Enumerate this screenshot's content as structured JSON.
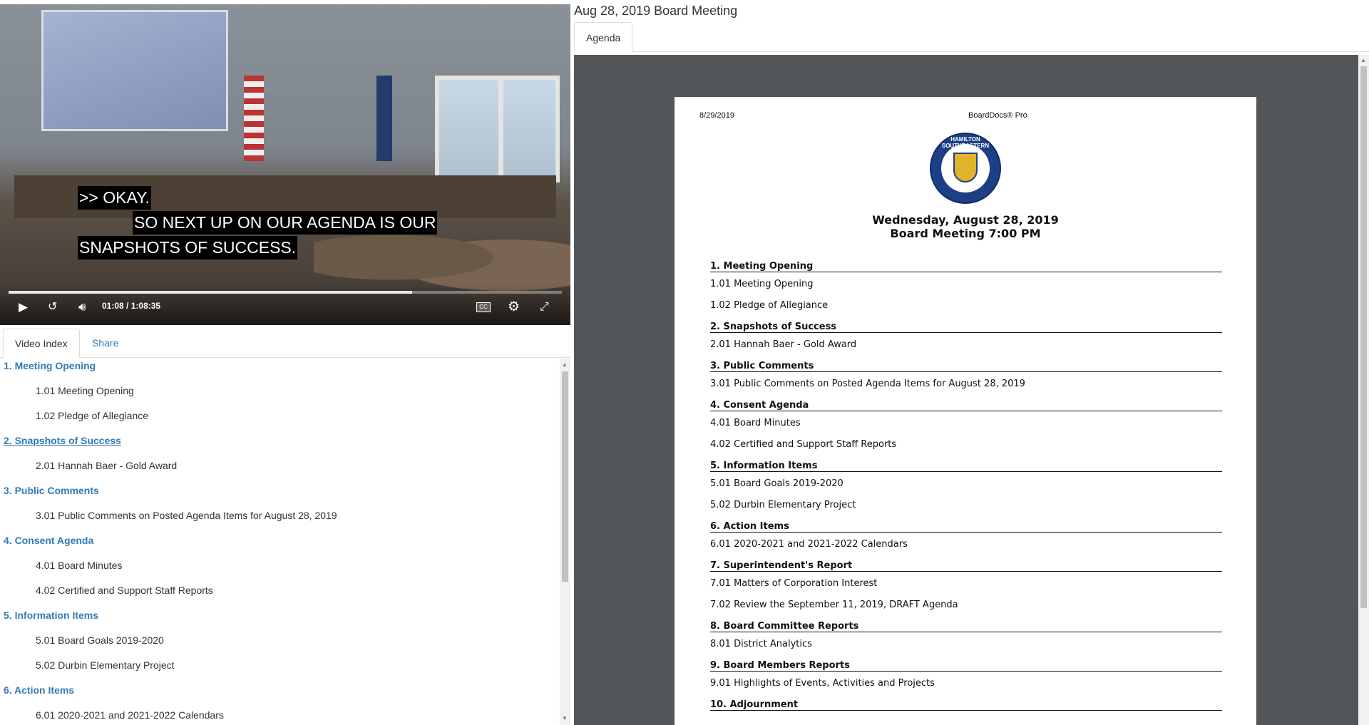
{
  "video": {
    "captions": [
      ">> OKAY.",
      "SO NEXT UP ON OUR AGENDA IS OUR",
      "SNAPSHOTS OF SUCCESS."
    ],
    "current_time": "01:08",
    "separator": "/",
    "duration": "1:08:35",
    "progress": 0.73,
    "cc_label": "CC"
  },
  "left_tabs": [
    "Video Index",
    "Share"
  ],
  "video_index": [
    {
      "label": "1. Meeting Opening",
      "items": [
        "1.01 Meeting Opening",
        "1.02 Pledge of Allegiance"
      ]
    },
    {
      "label": "2. Snapshots of Success",
      "items": [
        "2.01 Hannah Baer - Gold Award"
      ]
    },
    {
      "label": "3. Public Comments",
      "items": [
        "3.01 Public Comments on Posted Agenda Items for August 28, 2019"
      ]
    },
    {
      "label": "4. Consent Agenda",
      "items": [
        "4.01 Board Minutes",
        "4.02 Certified and Support Staff Reports"
      ]
    },
    {
      "label": "5. Information Items",
      "items": [
        "5.01 Board Goals 2019-2020",
        "5.02 Durbin Elementary Project"
      ]
    },
    {
      "label": "6. Action Items",
      "items": [
        "6.01 2020-2021 and 2021-2022 Calendars"
      ]
    }
  ],
  "meeting_title": "Aug 28, 2019 Board Meeting",
  "right_tabs": [
    "Agenda"
  ],
  "document": {
    "print_date": "8/29/2019",
    "brand": "BoardDocs® Pro",
    "seal_text": "HAMILTON SOUTHEASTERN SCHOOLS",
    "meeting_date": "Wednesday, August 28, 2019",
    "meeting_time": "Board Meeting 7:00 PM",
    "sections": [
      {
        "label": "1. Meeting Opening",
        "items": [
          "1.01 Meeting Opening",
          "1.02 Pledge of Allegiance"
        ]
      },
      {
        "label": "2. Snapshots of Success",
        "items": [
          "2.01 Hannah Baer - Gold Award"
        ]
      },
      {
        "label": "3. Public Comments",
        "items": [
          "3.01 Public Comments on Posted Agenda Items for August 28, 2019"
        ]
      },
      {
        "label": "4. Consent Agenda",
        "items": [
          "4.01 Board Minutes",
          "4.02 Certified and Support Staff Reports"
        ]
      },
      {
        "label": "5. Information Items",
        "items": [
          "5.01 Board Goals 2019-2020",
          "5.02 Durbin Elementary Project"
        ]
      },
      {
        "label": "6. Action Items",
        "items": [
          "6.01 2020-2021 and 2021-2022 Calendars"
        ]
      },
      {
        "label": "7. Superintendent's Report",
        "items": [
          "7.01 Matters of Corporation Interest",
          "7.02 Review the September 11, 2019, DRAFT Agenda"
        ]
      },
      {
        "label": "8. Board Committee Reports",
        "items": [
          "8.01 District Analytics"
        ]
      },
      {
        "label": "9. Board Members Reports",
        "items": [
          "9.01 Highlights of Events, Activities and Projects"
        ]
      },
      {
        "label": "10. Adjournment",
        "items": []
      }
    ]
  }
}
